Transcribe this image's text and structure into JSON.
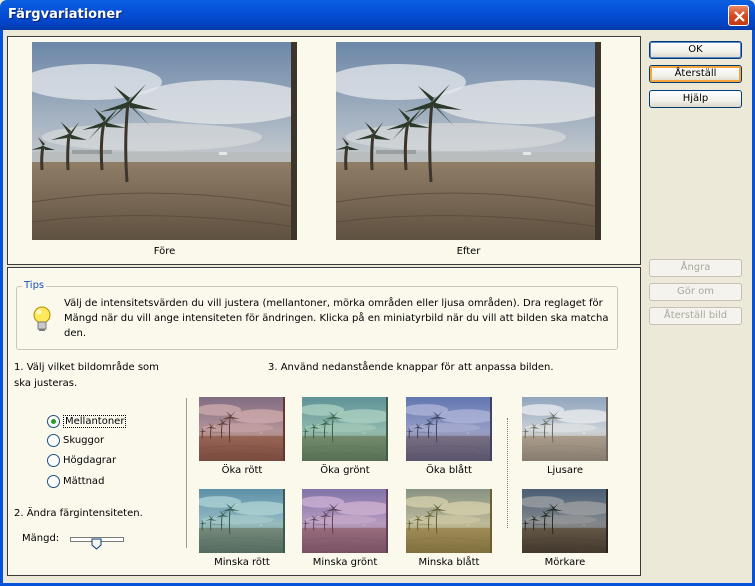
{
  "window": {
    "title": "Färgvariationer"
  },
  "preview": {
    "before_label": "Före",
    "after_label": "Efter"
  },
  "tips": {
    "legend": "Tips",
    "text": "Välj de intensitetsvärden du vill justera (mellantoner, mörka områden eller ljusa områden). Dra reglaget för Mängd när du vill ange intensiteten för ändringen. Klicka på en miniatyrbild när du vill att bilden ska matcha den."
  },
  "step1": {
    "label": "1. Välj vilket bildområde som ska justeras.",
    "options": [
      "Mellantoner",
      "Skuggor",
      "Högdagrar",
      "Mättnad"
    ],
    "selected": "Mellantoner"
  },
  "step2": {
    "label": "2. Ändra färgintensiteten.",
    "amount_label": "Mängd:"
  },
  "step3": {
    "label": "3. Använd nedanstående knappar för att anpassa bilden."
  },
  "variations": {
    "increase": [
      "Öka rött",
      "Öka grönt",
      "Öka blått"
    ],
    "decrease": [
      "Minska rött",
      "Minska grönt",
      "Minska blått"
    ],
    "lighter": "Ljusare",
    "darker": "Mörkare"
  },
  "buttons": {
    "ok": "OK",
    "reset": "Återställ",
    "help": "Hjälp",
    "undo": "Ångra",
    "redo": "Gör om",
    "reset_image": "Återställ bild"
  },
  "colors": {
    "title_bar": "#0553d8",
    "panel_bg": "#fbf8ec",
    "tips_legend": "#1850c8",
    "radio_selected": "#21a121"
  }
}
